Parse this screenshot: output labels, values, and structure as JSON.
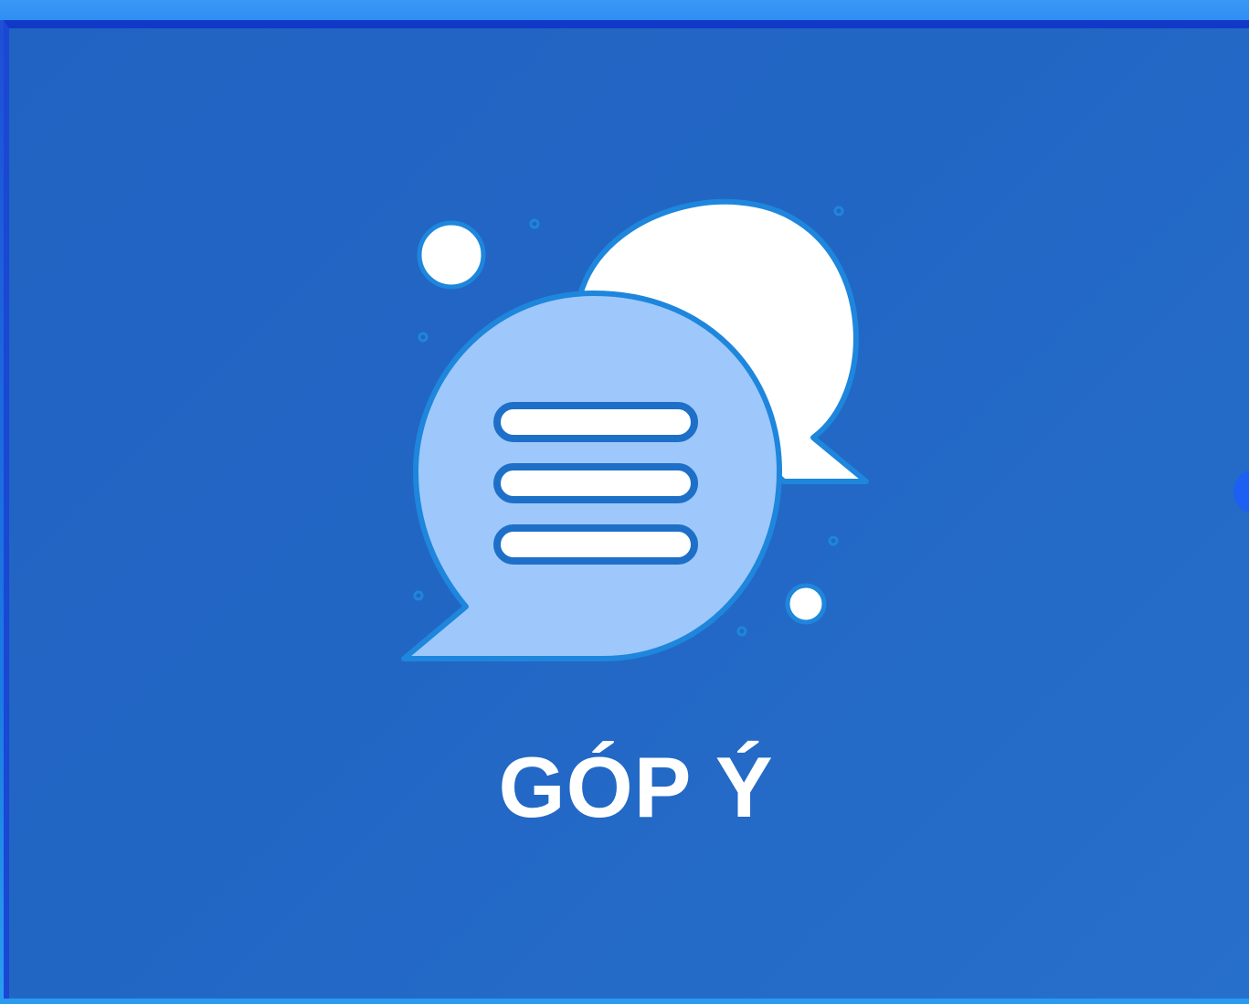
{
  "tile": {
    "label": "GÓP Ý",
    "icon": "chat-bubbles-icon"
  },
  "colors": {
    "background": "#2266c4",
    "bubble_front": "#9ec8fb",
    "bubble_back": "#ffffff",
    "outline": "#1f86dc",
    "label": "#ffffff"
  }
}
